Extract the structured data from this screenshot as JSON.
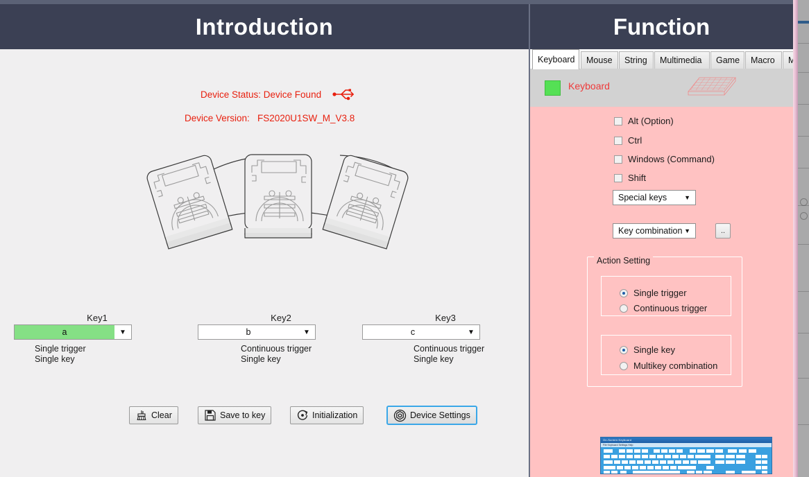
{
  "window": {
    "left_panel_title": "Introduction",
    "right_panel_title": "Function"
  },
  "device": {
    "status_text": "Device Status: Device Found",
    "version_label": "Device Version:",
    "version_value": "FS2020U1SW_M_V3.8",
    "status_color": "#e8200f",
    "usb_icon": "usb-icon"
  },
  "illustration": {
    "name": "foot-pedal-illustration",
    "pedal_count": 3
  },
  "keys": [
    {
      "label": "Key1",
      "value": "a",
      "selected": true,
      "highlight_color": "#85e085",
      "trigger": "Single trigger",
      "mode": "Single key"
    },
    {
      "label": "Key2",
      "value": "b",
      "selected": false,
      "trigger": "Continuous trigger",
      "mode": "Single key"
    },
    {
      "label": "Key3",
      "value": "c",
      "selected": false,
      "trigger": "Continuous trigger",
      "mode": "Single key"
    }
  ],
  "buttons": {
    "clear": "Clear",
    "save_to_key": "Save to key",
    "initialization": "Initialization",
    "device_settings": "Device Settings",
    "focus_color": "#3aa7e8"
  },
  "tabs": [
    {
      "label": "Keyboard",
      "active": true
    },
    {
      "label": "Mouse",
      "active": false
    },
    {
      "label": "String",
      "active": false
    },
    {
      "label": "Multimedia",
      "active": false
    },
    {
      "label": "Game",
      "active": false
    },
    {
      "label": "Macro",
      "active": false
    },
    {
      "label": "MIDI",
      "active": false
    }
  ],
  "keyboard_tab": {
    "header_label": "Keyboard",
    "header_label_color": "#ef3a3a",
    "swatch_color": "#55e055",
    "modifiers": [
      {
        "label": "Alt (Option)",
        "checked": false
      },
      {
        "label": "Ctrl",
        "checked": false
      },
      {
        "label": "Windows (Command)",
        "checked": false
      },
      {
        "label": "Shift",
        "checked": false
      }
    ],
    "special_keys_dropdown": "Special keys",
    "key_combination_dropdown": "Key combination",
    "browse_button": "..",
    "action_setting": {
      "legend": "Action Setting",
      "trigger_options": [
        {
          "label": "Single trigger",
          "checked": true
        },
        {
          "label": "Continuous trigger",
          "checked": false
        }
      ],
      "key_options": [
        {
          "label": "Single key",
          "checked": true
        },
        {
          "label": "Multikey  combination",
          "checked": false
        }
      ]
    },
    "osk": {
      "title": "On-Screen Keyboard",
      "menu": "File   Keyboard   Settings   Help"
    }
  },
  "theme": {
    "header_bg": "#3b4054",
    "left_bg": "#f0eff0",
    "right_bg": "#ffc2c2",
    "tab_bar_bg": "#d2d2d2"
  }
}
